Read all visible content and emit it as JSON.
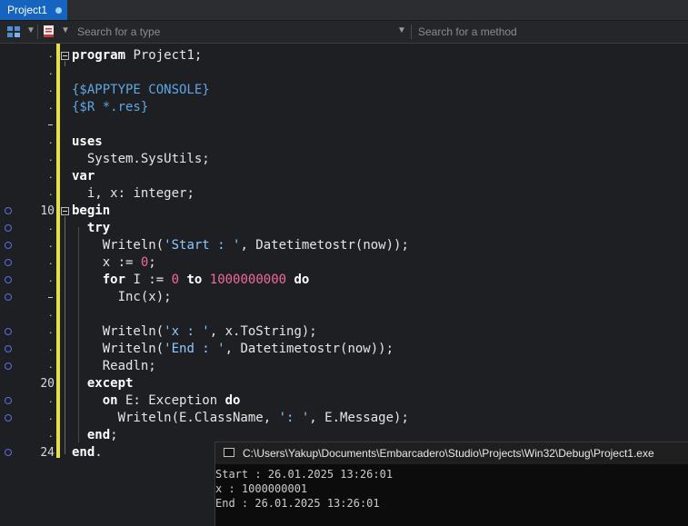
{
  "tab": {
    "title": "Project1"
  },
  "toolbar": {
    "type_search_placeholder": "Search for a type",
    "method_search_placeholder": "Search for a method"
  },
  "gutter": {
    "line_10": "10",
    "line_20": "20",
    "line_24": "24"
  },
  "code": {
    "l1_kw": "program",
    "l1_rest": " Project1;",
    "l3": "{$APPTYPE CONSOLE}",
    "l4": "{$R *.res}",
    "l6": "uses",
    "l7": "  System.SysUtils;",
    "l8": "var",
    "l9_a": "  i, x: ",
    "l9_kw": "integer",
    "l9_b": ";",
    "l10": "begin",
    "l11": "  try",
    "l12_a": "    Writeln(",
    "l12_str": "'Start : '",
    "l12_b": ", Datetimetostr(now));",
    "l13_a": "    x := ",
    "l13_num": "0",
    "l13_b": ";",
    "l14_kw1": "    for",
    "l14_a": " I := ",
    "l14_num1": "0",
    "l14_sp": " ",
    "l14_kw2": "to",
    "l14_sp2": " ",
    "l14_num2": "1000000000",
    "l14_sp3": " ",
    "l14_kw3": "do",
    "l15": "      Inc(x);",
    "l17_a": "    Writeln(",
    "l17_str": "'x : '",
    "l17_b": ", x.ToString);",
    "l18_a": "    Writeln(",
    "l18_str": "'End : '",
    "l18_b": ", Datetimetostr(now));",
    "l19": "    Readln;",
    "l20": "  except",
    "l21_kw1": "    on",
    "l21_a": " E: Exception ",
    "l21_kw2": "do",
    "l22_a": "      Writeln(E.ClassName, ",
    "l22_str": "': '",
    "l22_b": ", E.Message);",
    "l23_kw": "  end",
    "l23_b": ";",
    "l24_kw": "end",
    "l24_b": "."
  },
  "console": {
    "title": "C:\\Users\\Yakup\\Documents\\Embarcadero\\Studio\\Projects\\Win32\\Debug\\Project1.exe",
    "lines": [
      "Start : 26.01.2025 13:26:01",
      "x : 1000000001",
      "End : 26.01.2025 13:26:01"
    ]
  }
}
